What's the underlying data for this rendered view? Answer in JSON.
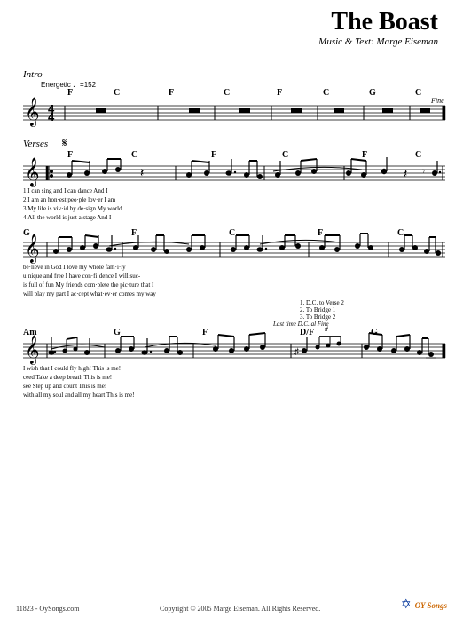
{
  "title": "The Boast",
  "subtitle": "Music & Text: Marge Eiseman",
  "intro_label": "Intro",
  "tempo_label": "Energetic ♩=152",
  "verses_label": "Verses",
  "section_sign": "𝄋",
  "lyrics": {
    "line1": "1.I  can  sing         and  I   can  dance          And  I",
    "line2": "2.I   am    an  hon·est  peo·ple  lov·er           I  am",
    "line3": "3.My  life    is  viv·id  by    de·sign            My  world",
    "line4": "4.All  the  world        is  just    a  stage       And  I",
    "line5": "be·lieve  in  God      I   love  my   whole  fam·i·ly",
    "line6": "u·nique   and  free    I   have   con·fi·dence     I will suc-",
    "line7": "is  full   of  fun     My  friends com·plete  the  pic·ture  that  I",
    "line8": "will  play  my  part   I  ac·cept  what·ev·er  comes  my  way",
    "line9": "I   wish   that   I    could    fly         high!     This  is  me!",
    "line10": "ceed            Take   a    deep   breath            This  is  me!",
    "line11": "see             Step   up    and   count             This  is  me!",
    "line12": "with  all  my  soul   and   all         my   heart   This  is  me!"
  },
  "navigation_labels": {
    "dc_verse2": "1. D.C. to Verse 2",
    "to_bridge1": "2. To Bridge 1",
    "to_bridge2": "3. To Bridge 2",
    "last_time": "Last time D.C. al Fine"
  },
  "footer": {
    "catalog": "11823 - OySongs.com",
    "copyright": "Copyright © 2005 Marge Eiseman. All Rights Reserved.",
    "brand": "OY Songs"
  },
  "fine_label": "Fine",
  "chords": {
    "intro": [
      "F",
      "C",
      "F",
      "C",
      "F",
      "C",
      "G",
      "C"
    ],
    "verse1": [
      "F",
      "C",
      "F",
      "C",
      "F",
      "C"
    ],
    "verse2": [
      "G",
      "F",
      "C",
      "F",
      "C"
    ],
    "bridge": [
      "Am",
      "G",
      "F",
      "D/F#",
      "G"
    ]
  }
}
